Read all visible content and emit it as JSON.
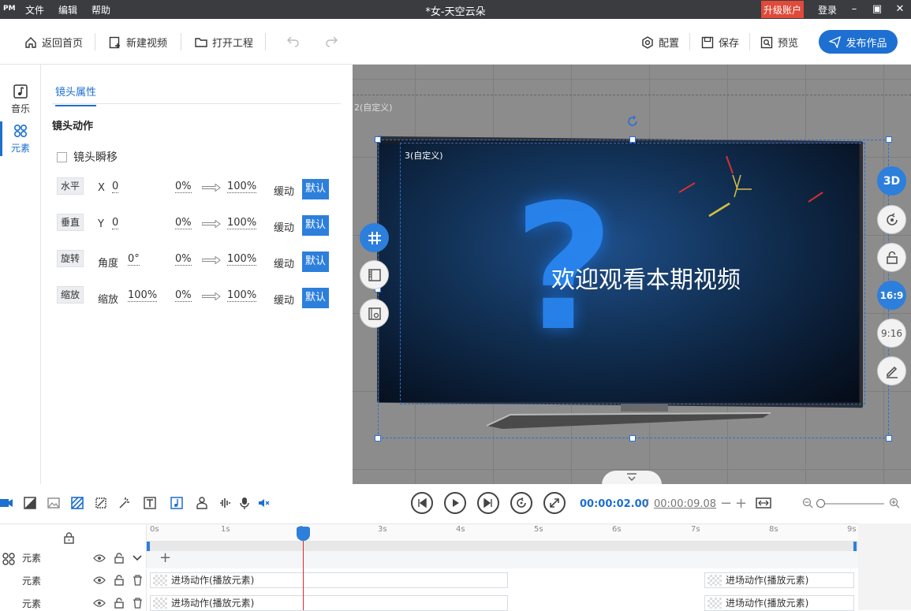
{
  "app": {
    "logo": "PM",
    "menu": [
      "文件",
      "编辑",
      "帮助"
    ],
    "window_title": "*女-天空云朵",
    "upgrade_label": "升级账户",
    "login_label": "登录"
  },
  "toolbar": {
    "home": "返回首页",
    "new_video": "新建视频",
    "open_project": "打开工程",
    "config": "配置",
    "save": "保存",
    "preview": "预览",
    "publish": "发布作品"
  },
  "left_rail": {
    "items": [
      {
        "label": "音乐",
        "icon": "music-icon"
      },
      {
        "label": "元素",
        "icon": "elements-icon",
        "active": true
      }
    ]
  },
  "panel": {
    "tab": "镜头属性",
    "section_title": "镜头动作",
    "checkbox_label": "镜头瞬移",
    "rows": [
      {
        "tag": "水平",
        "label": "X",
        "value": "0",
        "from": "0%",
        "to": "100%",
        "ease": "缓动",
        "default": "默认"
      },
      {
        "tag": "垂直",
        "label": "Y",
        "value": "0",
        "from": "0%",
        "to": "100%",
        "ease": "缓动",
        "default": "默认"
      },
      {
        "tag": "旋转",
        "label": "角度",
        "value": "0°",
        "from": "0%",
        "to": "100%",
        "ease": "缓动",
        "default": "默认"
      },
      {
        "tag": "缩放",
        "label": "缩放",
        "value": "100%",
        "from": "0%",
        "to": "100%",
        "ease": "缓动",
        "default": "默认"
      }
    ]
  },
  "stage": {
    "camera_label_outer": "2(自定义)",
    "camera_label_inner": "3(自定义)",
    "screen_text": "欢迎观看本期视频",
    "right_buttons": [
      "3D",
      "旋转",
      "解锁",
      "16:9",
      "9:16",
      "编辑"
    ]
  },
  "timeline": {
    "current_time": "00:00:02.00",
    "separator": "/",
    "total_time": "00:00:09.08",
    "ruler_ticks": [
      "0s",
      "1s",
      "2s",
      "3s",
      "4s",
      "5s",
      "6s",
      "7s",
      "8s",
      "9s"
    ],
    "playhead_time_s": 2.0,
    "tracks": [
      {
        "label": "元素",
        "clips": []
      },
      {
        "label": "元素",
        "clips": [
          "进场动作(播放元素)",
          "进场动作(播放元素)"
        ]
      },
      {
        "label": "元素",
        "clips": [
          "进场动作(播放元素)",
          "进场动作(播放元素)"
        ]
      }
    ]
  },
  "colors": {
    "accent": "#1d6fd1",
    "titlebar": "#3a3c40",
    "upgrade": "#e04a3a",
    "stage_bg": "#8c8c8c"
  }
}
